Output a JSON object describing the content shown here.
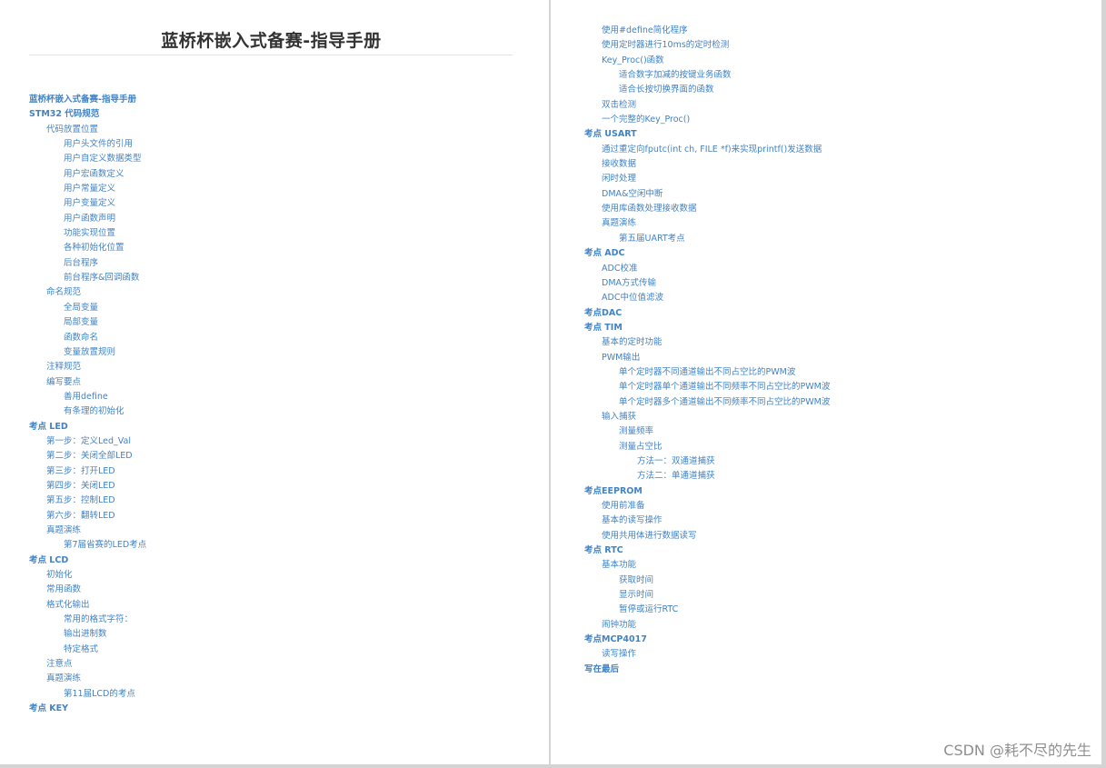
{
  "document": {
    "title": "蓝桥杯嵌入式备赛-指导手册"
  },
  "toc_left": [
    {
      "level": 1,
      "text": "蓝桥杯嵌入式备赛-指导手册"
    },
    {
      "level": 1,
      "text": "STM32 代码规范"
    },
    {
      "level": 2,
      "text": "代码放置位置"
    },
    {
      "level": 3,
      "text": "用户头文件的引用"
    },
    {
      "level": 3,
      "text": "用户自定义数据类型"
    },
    {
      "level": 3,
      "text": "用户宏函数定义"
    },
    {
      "level": 3,
      "text": "用户常量定义"
    },
    {
      "level": 3,
      "text": "用户变量定义"
    },
    {
      "level": 3,
      "text": "用户函数声明"
    },
    {
      "level": 3,
      "text": "功能实现位置"
    },
    {
      "level": 3,
      "text": "各种初始化位置"
    },
    {
      "level": 3,
      "text": "后台程序"
    },
    {
      "level": 3,
      "text": "前台程序&回调函数"
    },
    {
      "level": 2,
      "text": "命名规范"
    },
    {
      "level": 3,
      "text": "全局变量"
    },
    {
      "level": 3,
      "text": "局部变量"
    },
    {
      "level": 3,
      "text": "函数命名"
    },
    {
      "level": 3,
      "text": "变量放置规则"
    },
    {
      "level": 2,
      "text": "注释规范"
    },
    {
      "level": 2,
      "text": "编写要点"
    },
    {
      "level": 3,
      "text": "善用define"
    },
    {
      "level": 3,
      "text": "有条理的初始化"
    },
    {
      "level": 1,
      "text": "考点 LED"
    },
    {
      "level": 2,
      "text": "第一步：定义Led_Val"
    },
    {
      "level": 2,
      "text": "第二步：关闭全部LED"
    },
    {
      "level": 2,
      "text": "第三步：打开LED"
    },
    {
      "level": 2,
      "text": "第四步：关闭LED"
    },
    {
      "level": 2,
      "text": "第五步：控制LED"
    },
    {
      "level": 2,
      "text": "第六步：翻转LED"
    },
    {
      "level": 2,
      "text": "真题演练"
    },
    {
      "level": 3,
      "text": "第7届省赛的LED考点"
    },
    {
      "level": 1,
      "text": "考点 LCD"
    },
    {
      "level": 2,
      "text": "初始化"
    },
    {
      "level": 2,
      "text": "常用函数"
    },
    {
      "level": 2,
      "text": "格式化输出"
    },
    {
      "level": 3,
      "text": "常用的格式字符："
    },
    {
      "level": 3,
      "text": "输出进制数"
    },
    {
      "level": 3,
      "text": "特定格式"
    },
    {
      "level": 2,
      "text": "注意点"
    },
    {
      "level": 2,
      "text": "真题演练"
    },
    {
      "level": 3,
      "text": "第11届LCD的考点"
    },
    {
      "level": 1,
      "text": "考点 KEY"
    }
  ],
  "toc_right": [
    {
      "level": 2,
      "text": "使用#define简化程序"
    },
    {
      "level": 2,
      "text": "使用定时器进行10ms的定时检测"
    },
    {
      "level": 2,
      "text": "Key_Proc()函数"
    },
    {
      "level": 3,
      "text": "适合数字加减的按键业务函数"
    },
    {
      "level": 3,
      "text": "适合长按切换界面的函数"
    },
    {
      "level": 2,
      "text": "双击检测"
    },
    {
      "level": 2,
      "text": "一个完整的Key_Proc()"
    },
    {
      "level": 1,
      "text": "考点 USART"
    },
    {
      "level": 2,
      "text": "通过重定向fputc(int ch, FILE *f)来实现printf()发送数据"
    },
    {
      "level": 2,
      "text": "接收数据"
    },
    {
      "level": 2,
      "text": "闲时处理"
    },
    {
      "level": 2,
      "text": "DMA&空闲中断"
    },
    {
      "level": 2,
      "text": "使用库函数处理接收数据"
    },
    {
      "level": 2,
      "text": "真题演练"
    },
    {
      "level": 3,
      "text": "第五届UART考点"
    },
    {
      "level": 1,
      "text": "考点 ADC"
    },
    {
      "level": 2,
      "text": "ADC校准"
    },
    {
      "level": 2,
      "text": "DMA方式传输"
    },
    {
      "level": 2,
      "text": "ADC中位值滤波"
    },
    {
      "level": 1,
      "text": "考点DAC"
    },
    {
      "level": 1,
      "text": "考点 TIM"
    },
    {
      "level": 2,
      "text": "基本的定时功能"
    },
    {
      "level": 2,
      "text": "PWM输出"
    },
    {
      "level": 3,
      "text": "单个定时器不同通道输出不同占空比的PWM波"
    },
    {
      "level": 3,
      "text": "单个定时器单个通道输出不同频率不同占空比的PWM波"
    },
    {
      "level": 3,
      "text": "单个定时器多个通道输出不同频率不同占空比的PWM波"
    },
    {
      "level": 2,
      "text": "输入捕获"
    },
    {
      "level": 3,
      "text": "测量频率"
    },
    {
      "level": 3,
      "text": "测量占空比"
    },
    {
      "level": 4,
      "text": "方法一：双通道捕获"
    },
    {
      "level": 4,
      "text": "方法二：单通道捕获"
    },
    {
      "level": 1,
      "text": "考点EEPROM"
    },
    {
      "level": 2,
      "text": "使用前准备"
    },
    {
      "level": 2,
      "text": "基本的读写操作"
    },
    {
      "level": 2,
      "text": "使用共用体进行数据读写"
    },
    {
      "level": 1,
      "text": "考点 RTC"
    },
    {
      "level": 2,
      "text": "基本功能"
    },
    {
      "level": 3,
      "text": "获取时间"
    },
    {
      "level": 3,
      "text": "显示时间"
    },
    {
      "level": 3,
      "text": "暂停或运行RTC"
    },
    {
      "level": 2,
      "text": "闹钟功能"
    },
    {
      "level": 1,
      "text": "考点MCP4017"
    },
    {
      "level": 2,
      "text": "读写操作"
    },
    {
      "level": 1,
      "text": "写在最后"
    }
  ],
  "watermark": "CSDN @耗不尽的先生",
  "colors": {
    "link": "#4183c4",
    "title": "#333333",
    "page_bg": "#ffffff",
    "gutter": "#d4d4d4"
  }
}
